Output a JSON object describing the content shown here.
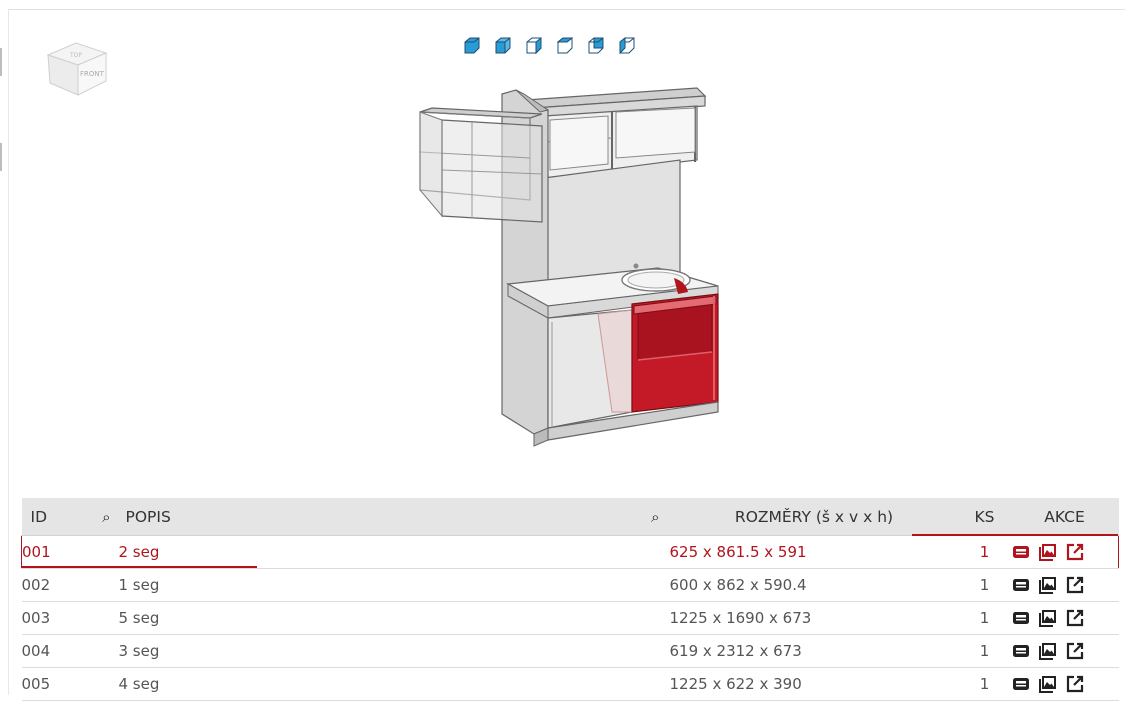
{
  "nav_cube": {
    "label_front": "FRONT",
    "label_top": "TOP"
  },
  "view_buttons": [
    {
      "name": "view-iso-1-icon"
    },
    {
      "name": "view-iso-2-icon"
    },
    {
      "name": "view-iso-3-icon"
    },
    {
      "name": "view-iso-4-icon"
    },
    {
      "name": "view-iso-5-icon"
    },
    {
      "name": "view-iso-6-icon"
    }
  ],
  "table": {
    "headers": {
      "id": "ID",
      "popis": "POPIS",
      "rozmery": "ROZMĚRY (š x v x h)",
      "ks": "KS",
      "akce": "AKCE"
    },
    "rows": [
      {
        "id": "001",
        "popis": "2 seg",
        "rozmery": "625 x 861.5 x 591",
        "ks": "1",
        "selected": true
      },
      {
        "id": "002",
        "popis": "1 seg",
        "rozmery": "600 x 862 x 590.4",
        "ks": "1",
        "selected": false
      },
      {
        "id": "003",
        "popis": "5 seg",
        "rozmery": "1225 x 1690 x 673",
        "ks": "1",
        "selected": false
      },
      {
        "id": "004",
        "popis": "3 seg",
        "rozmery": "619 x 2312 x 673",
        "ks": "1",
        "selected": false
      },
      {
        "id": "005",
        "popis": "4 seg",
        "rozmery": "1225 x 622 x 390",
        "ks": "1",
        "selected": false
      }
    ]
  },
  "colors": {
    "accent": "#b0141c",
    "view_icon": "#2a9bd4",
    "header_bg": "#e5e5e5"
  }
}
